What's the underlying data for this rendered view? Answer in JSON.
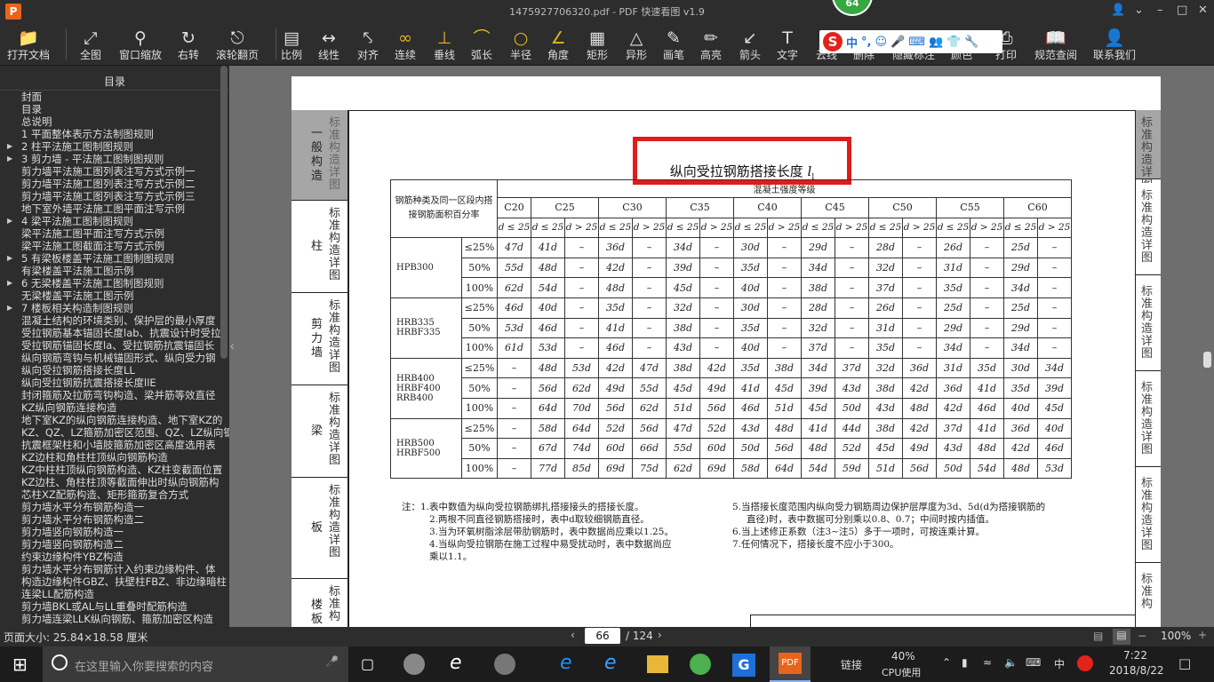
{
  "window": {
    "title": "1475927706320.pdf - PDF 快速看图 v1.9",
    "badge": "64",
    "app_icon": "P"
  },
  "toolbar": {
    "items": [
      {
        "label": "打开文档",
        "icon": "folder-icon"
      },
      {
        "label": "全图",
        "icon": "fit-screen-icon"
      },
      {
        "label": "窗口缩放",
        "icon": "magnifier-icon"
      },
      {
        "label": "右转",
        "icon": "rotate-icon"
      },
      {
        "label": "滚轮翻页",
        "icon": "mouse-icon"
      },
      {
        "label": "比例",
        "icon": "scale-icon"
      },
      {
        "label": "线性",
        "icon": "linear-icon"
      },
      {
        "label": "对齐",
        "icon": "align-icon"
      },
      {
        "label": "连续",
        "icon": "continuous-icon"
      },
      {
        "label": "垂线",
        "icon": "perpendicular-icon"
      },
      {
        "label": "弧长",
        "icon": "arc-icon"
      },
      {
        "label": "半径",
        "icon": "radius-icon"
      },
      {
        "label": "角度",
        "icon": "angle-icon"
      },
      {
        "label": "矩形",
        "icon": "rectangle-icon"
      },
      {
        "label": "异形",
        "icon": "polygon-icon"
      },
      {
        "label": "画笔",
        "icon": "pen-icon"
      },
      {
        "label": "高亮",
        "icon": "highlight-icon"
      },
      {
        "label": "箭头",
        "icon": "arrow-icon"
      },
      {
        "label": "文字",
        "icon": "text-icon"
      },
      {
        "label": "云线",
        "icon": "cloud-icon"
      },
      {
        "label": "删除",
        "icon": "delete-icon"
      },
      {
        "label": "隐藏标注",
        "icon": "hide-icon"
      },
      {
        "label": "颜色",
        "icon": "color-icon"
      },
      {
        "label": "打印",
        "icon": "print-icon"
      },
      {
        "label": "规范查阅",
        "icon": "book-icon"
      },
      {
        "label": "联系我们",
        "icon": "contact-icon"
      }
    ]
  },
  "ime": {
    "logo": "S",
    "lang": "中"
  },
  "sidebar": {
    "title": "目录",
    "items": [
      {
        "label": "封面",
        "arrow": false
      },
      {
        "label": "目录",
        "arrow": false
      },
      {
        "label": "总说明",
        "arrow": false
      },
      {
        "label": "1 平面整体表示方法制图规则",
        "arrow": false
      },
      {
        "label": "2 柱平法施工图制图规则",
        "arrow": true
      },
      {
        "label": "3 剪力墙 - 平法施工图制图规则",
        "arrow": true
      },
      {
        "label": "剪力墙平法施工图列表注写方式示例一",
        "arrow": false
      },
      {
        "label": "剪力墙平法施工图列表注写方式示例二",
        "arrow": false
      },
      {
        "label": "剪力墙平法施工图列表注写方式示例三",
        "arrow": false
      },
      {
        "label": "地下室外墙平法施工图平面注写示例",
        "arrow": false
      },
      {
        "label": "4 梁平法施工图制图规则",
        "arrow": true
      },
      {
        "label": "梁平法施工图平面注写方式示例",
        "arrow": false
      },
      {
        "label": "梁平法施工图截面注写方式示例",
        "arrow": false
      },
      {
        "label": "5 有梁板楼盖平法施工图制图规则",
        "arrow": true
      },
      {
        "label": "有梁楼盖平法施工图示例",
        "arrow": false
      },
      {
        "label": "6 无梁楼盖平法施工图制图规则",
        "arrow": true
      },
      {
        "label": "无梁楼盖平法施工图示例",
        "arrow": false
      },
      {
        "label": "7 楼板相关构造制图规则",
        "arrow": true
      },
      {
        "label": "混凝土结构的环境类别、保护层的最小厚度",
        "arrow": false
      },
      {
        "label": "受拉钢筋基本锚固长度lab、抗震设计时受拉",
        "arrow": false
      },
      {
        "label": "受拉钢筋锚固长度la、受拉钢筋抗震锚固长",
        "arrow": false
      },
      {
        "label": "纵向钢筋弯钩与机械锚固形式、纵向受力钢",
        "arrow": false
      },
      {
        "label": "纵向受拉钢筋搭接长度LL",
        "arrow": false
      },
      {
        "label": "纵向受拉钢筋抗震搭接长度llE",
        "arrow": false
      },
      {
        "label": "封闭箍筋及拉筋弯钩构造、梁并筋等效直径",
        "arrow": false
      },
      {
        "label": "KZ纵向钢筋连接构造",
        "arrow": false
      },
      {
        "label": "地下室KZ的纵向钢筋连接构造、地下室KZ的",
        "arrow": false
      },
      {
        "label": "KZ、QZ、LZ箍筋加密区范围、QZ、LZ纵向钢",
        "arrow": false
      },
      {
        "label": "抗震框架柱和小墙肢箍筋加密区高度选用表",
        "arrow": false
      },
      {
        "label": "KZ边柱和角柱柱顶纵向钢筋构造",
        "arrow": false
      },
      {
        "label": "KZ中柱柱顶纵向钢筋构造、KZ柱变截面位置",
        "arrow": false
      },
      {
        "label": "KZ边柱、角柱柱顶等截面伸出时纵向钢筋构",
        "arrow": false
      },
      {
        "label": "芯柱XZ配筋构造、矩形箍筋复合方式",
        "arrow": false
      },
      {
        "label": "剪力墙水平分布钢筋构造一",
        "arrow": false
      },
      {
        "label": "剪力墙水平分布钢筋构造二",
        "arrow": false
      },
      {
        "label": "剪力墙竖向钢筋构造一",
        "arrow": false
      },
      {
        "label": "剪力墙竖向钢筋构造二",
        "arrow": false
      },
      {
        "label": "约束边缘构件YBZ构造",
        "arrow": false
      },
      {
        "label": "剪力墙水平分布钢筋计入约束边缘构件、体",
        "arrow": false
      },
      {
        "label": "构造边缘构件GBZ、扶壁柱FBZ、非边缘暗柱",
        "arrow": false
      },
      {
        "label": "连梁LL配筋构造",
        "arrow": false
      },
      {
        "label": "剪力墙BKL或AL与LL重叠时配筋构造",
        "arrow": false
      },
      {
        "label": "剪力墙连梁LLK纵向钢筋、箍筋加密区构造",
        "arrow": false
      }
    ]
  },
  "page": {
    "side_tabs_left": [
      {
        "cat": "一般构造",
        "desc": "标准构造详图",
        "active": true
      },
      {
        "cat": "柱",
        "desc": "标准构造详图",
        "active": false
      },
      {
        "cat": "剪力墙",
        "desc": "标准构造详图",
        "active": false
      },
      {
        "cat": "梁",
        "desc": "标准构造详图",
        "active": false
      },
      {
        "cat": "板",
        "desc": "标准构造详图",
        "active": false
      },
      {
        "cat": "楼板相",
        "desc": "标准构",
        "active": false
      }
    ],
    "side_tabs_right": [
      "标准构造详图",
      "标准构造详图",
      "标准构造详图",
      "标准构造详图",
      "标准构造详图",
      "标准构"
    ],
    "table_title": "纵向受拉钢筋搭接长度",
    "table_title_symbol": "l",
    "table_title_sub": "l",
    "table": {
      "header_left": "钢筋种类及同一区段内搭接钢筋面积百分率",
      "header_right": "混凝土强度等级",
      "grades": [
        "C20",
        "C25",
        "C30",
        "C35",
        "C40",
        "C45",
        "C50",
        "C55",
        "C60"
      ],
      "sub_first": "d ≤ 25",
      "sub_a": "d ≤ 25",
      "sub_b": "d > 25",
      "groups": [
        {
          "steel": "HPB300",
          "rows": [
            {
              "pct": "≤25%",
              "vals": [
                "47d",
                "41d",
                "–",
                "36d",
                "–",
                "34d",
                "–",
                "30d",
                "–",
                "29d",
                "–",
                "28d",
                "–",
                "26d",
                "–",
                "25d",
                "–"
              ]
            },
            {
              "pct": "50%",
              "vals": [
                "55d",
                "48d",
                "–",
                "42d",
                "–",
                "39d",
                "–",
                "35d",
                "–",
                "34d",
                "–",
                "32d",
                "–",
                "31d",
                "–",
                "29d",
                "–"
              ]
            },
            {
              "pct": "100%",
              "vals": [
                "62d",
                "54d",
                "–",
                "48d",
                "–",
                "45d",
                "–",
                "40d",
                "–",
                "38d",
                "–",
                "37d",
                "–",
                "35d",
                "–",
                "34d",
                "–"
              ]
            }
          ]
        },
        {
          "steel": "HRB335 HRBF335",
          "rows": [
            {
              "pct": "≤25%",
              "vals": [
                "46d",
                "40d",
                "–",
                "35d",
                "–",
                "32d",
                "–",
                "30d",
                "–",
                "28d",
                "–",
                "26d",
                "–",
                "25d",
                "–",
                "25d",
                "–"
              ]
            },
            {
              "pct": "50%",
              "vals": [
                "53d",
                "46d",
                "–",
                "41d",
                "–",
                "38d",
                "–",
                "35d",
                "–",
                "32d",
                "–",
                "31d",
                "–",
                "29d",
                "–",
                "29d",
                "–"
              ]
            },
            {
              "pct": "100%",
              "vals": [
                "61d",
                "53d",
                "–",
                "46d",
                "–",
                "43d",
                "–",
                "40d",
                "–",
                "37d",
                "–",
                "35d",
                "–",
                "34d",
                "–",
                "34d",
                "–"
              ]
            }
          ]
        },
        {
          "steel": "HRB400 HRBF400 RRB400",
          "rows": [
            {
              "pct": "≤25%",
              "vals": [
                "–",
                "48d",
                "53d",
                "42d",
                "47d",
                "38d",
                "42d",
                "35d",
                "38d",
                "34d",
                "37d",
                "32d",
                "36d",
                "31d",
                "35d",
                "30d",
                "34d"
              ]
            },
            {
              "pct": "50%",
              "vals": [
                "–",
                "56d",
                "62d",
                "49d",
                "55d",
                "45d",
                "49d",
                "41d",
                "45d",
                "39d",
                "43d",
                "38d",
                "42d",
                "36d",
                "41d",
                "35d",
                "39d"
              ]
            },
            {
              "pct": "100%",
              "vals": [
                "–",
                "64d",
                "70d",
                "56d",
                "62d",
                "51d",
                "56d",
                "46d",
                "51d",
                "45d",
                "50d",
                "43d",
                "48d",
                "42d",
                "46d",
                "40d",
                "45d"
              ]
            }
          ]
        },
        {
          "steel": "HRB500 HRBF500",
          "rows": [
            {
              "pct": "≤25%",
              "vals": [
                "–",
                "58d",
                "64d",
                "52d",
                "56d",
                "47d",
                "52d",
                "43d",
                "48d",
                "41d",
                "44d",
                "38d",
                "42d",
                "37d",
                "41d",
                "36d",
                "40d"
              ]
            },
            {
              "pct": "50%",
              "vals": [
                "–",
                "67d",
                "74d",
                "60d",
                "66d",
                "55d",
                "60d",
                "50d",
                "56d",
                "48d",
                "52d",
                "45d",
                "49d",
                "43d",
                "48d",
                "42d",
                "46d"
              ]
            },
            {
              "pct": "100%",
              "vals": [
                "–",
                "77d",
                "85d",
                "69d",
                "75d",
                "62d",
                "69d",
                "58d",
                "64d",
                "54d",
                "59d",
                "51d",
                "56d",
                "50d",
                "54d",
                "48d",
                "53d"
              ]
            }
          ]
        }
      ]
    },
    "notes_left": [
      "注：1.表中数值为纵向受拉钢筋绑扎搭接接头的搭接长度。",
      "2.两根不同直径钢筋搭接时，表中d取较细钢筋直径。",
      "3.当为环氧树脂涂层带肋钢筋时，表中数据尚应乘以1.25。",
      "4.当纵向受拉钢筋在施工过程中易受扰动时，表中数据尚应",
      "乘以1.1。"
    ],
    "notes_right": [
      "5.当搭接长度范围内纵向受力钢筋周边保护层厚度为3d、5d(d为搭接钢筋的",
      "直径)时，表中数据可分别乘以0.8、0.7；中间时按内插值。",
      "6.当上述修正系数（注3~注5）多于一项时，可按连乘计算。",
      "7.任何情况下，搭接长度不应小于300。"
    ]
  },
  "statusbar": {
    "page_size": "页面大小: 25.84×18.58 厘米",
    "current_page": "66",
    "total_pages": "/ 124",
    "zoom": "100%"
  },
  "taskbar": {
    "search_placeholder": "在这里输入你要搜索的内容",
    "link_label": "链接",
    "cpu_percent": "40%",
    "cpu_label": "CPU使用",
    "ime": "中",
    "time": "7:22",
    "date": "2018/8/22"
  }
}
